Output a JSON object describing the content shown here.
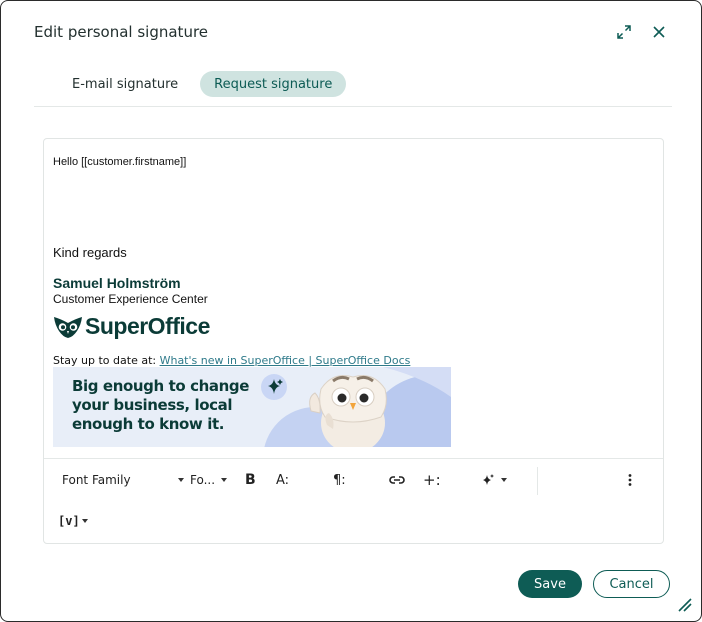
{
  "dialog": {
    "title": "Edit personal signature"
  },
  "tabs": [
    {
      "label": "E-mail signature",
      "active": false
    },
    {
      "label": "Request signature",
      "active": true
    }
  ],
  "editor": {
    "greeting": "Hello [[customer.firstname]]",
    "regards": "Kind regards",
    "signature_name": "Samuel Holmström",
    "signature_department": "Customer Experience Center",
    "logo_text": "SuperOffice",
    "stay_prefix": "Stay up to date at:",
    "stay_link": "What's new in SuperOffice | SuperOffice Docs",
    "banner_text": "Big enough to change your business, local enough to know it."
  },
  "toolbar": {
    "font_family": "Font Family",
    "font_size": "Fo...",
    "bold": "B",
    "font_style_icon": "A:",
    "paragraph_icon": "¶:",
    "insert_icon": "+:",
    "variable_label": "[v]"
  },
  "footer": {
    "save_label": "Save",
    "cancel_label": "Cancel"
  },
  "colors": {
    "primary": "#0e5c55",
    "tab_active_bg": "#cfe3e0",
    "link": "#2e7a8a",
    "brand_dark": "#0b3b37"
  }
}
